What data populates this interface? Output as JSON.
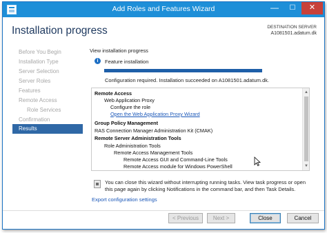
{
  "window": {
    "title": "Add Roles and Features Wizard",
    "min_glyph": "—",
    "max_glyph": "☐",
    "close_glyph": "✕"
  },
  "header": {
    "page_title": "Installation progress",
    "destination_label": "DESTINATION SERVER",
    "destination_server": "A1081501.adatum.dk"
  },
  "sidebar": {
    "items": [
      {
        "label": "Before You Begin",
        "level": 0,
        "active": false
      },
      {
        "label": "Installation Type",
        "level": 0,
        "active": false
      },
      {
        "label": "Server Selection",
        "level": 0,
        "active": false
      },
      {
        "label": "Server Roles",
        "level": 0,
        "active": false
      },
      {
        "label": "Features",
        "level": 0,
        "active": false
      },
      {
        "label": "Remote Access",
        "level": 0,
        "active": false
      },
      {
        "label": "Role Services",
        "level": 1,
        "active": false
      },
      {
        "label": "Confirmation",
        "level": 0,
        "active": false
      },
      {
        "label": "Results",
        "level": 0,
        "active": true
      }
    ]
  },
  "main": {
    "view_label": "View installation progress",
    "info_glyph": "i",
    "feature_label": "Feature installation",
    "progress_fraction": 1.0,
    "status_text": "Configuration required. Installation succeeded on A1081501.adatum.dk.",
    "results": [
      {
        "text": "Remote Access",
        "level": 0,
        "style": "bold"
      },
      {
        "text": "Web Application Proxy",
        "level": 1,
        "style": "normal"
      },
      {
        "text": "Configure the role",
        "level": 2,
        "style": "normal"
      },
      {
        "text": "Open the Web Application Proxy Wizard",
        "level": 2,
        "style": "link"
      },
      {
        "text": "Group Policy Management",
        "level": 0,
        "style": "bold"
      },
      {
        "text": "RAS Connection Manager Administration Kit (CMAK)",
        "level": 0,
        "style": "normal"
      },
      {
        "text": "Remote Server Administration Tools",
        "level": 0,
        "style": "bold"
      },
      {
        "text": "Role Administration Tools",
        "level": 1,
        "style": "normal"
      },
      {
        "text": "Remote Access Management Tools",
        "level": 2,
        "style": "normal"
      },
      {
        "text": "Remote Access GUI and Command-Line Tools",
        "level": 3,
        "style": "normal"
      },
      {
        "text": "Remote Access module for Windows PowerShell",
        "level": 3,
        "style": "normal"
      }
    ],
    "scroll_up_glyph": "▲",
    "scroll_down_glyph": "▼",
    "note_text": "You can close this wizard without interrupting running tasks. View task progress or open this page again by clicking Notifications in the command bar, and then Task Details.",
    "export_link": "Export configuration settings"
  },
  "footer": {
    "previous_label": "< Previous",
    "next_label": "Next >",
    "close_label": "Close",
    "cancel_label": "Cancel"
  },
  "colors": {
    "titlebar": "#1e8fd8",
    "active_nav": "#2f68a6",
    "progress": "#1e5fa8",
    "link": "#1a57b8"
  }
}
